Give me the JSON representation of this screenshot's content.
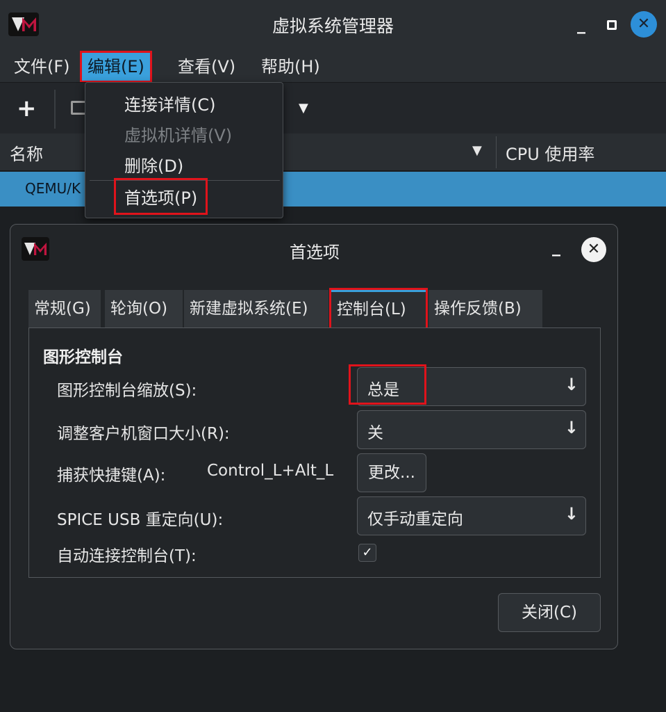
{
  "window": {
    "title": "虚拟系统管理器",
    "min_glyph": "_",
    "close_glyph": "✕"
  },
  "menubar": {
    "file": "文件(F)",
    "edit": "编辑(E)",
    "view": "查看(V)",
    "help": "帮助(H)"
  },
  "toolbar": {
    "add_glyph": "+",
    "dropdown_glyph": "▼"
  },
  "list": {
    "col_name": "名称",
    "col_sort_glyph": "▼",
    "col_cpu": "CPU 使用率",
    "row_text": "QEMU/K"
  },
  "edit_menu": {
    "connection_details": "连接详情(C)",
    "vm_details": "虚拟机详情(V)",
    "delete": "删除(D)",
    "preferences": "首选项(P)"
  },
  "dialog": {
    "title": "首选项",
    "min_glyph": "_",
    "close_glyph": "✕",
    "tabs": {
      "general": "常规(G)",
      "polling": "轮询(O)",
      "new_vm": "新建虚拟系统(E)",
      "console": "控制台(L)",
      "feedback": "操作反馈(B)"
    },
    "section_title": "图形控制台",
    "fields": {
      "scaling_label": "图形控制台缩放(S):",
      "scaling_value": "总是",
      "resize_label": "调整客户机窗口大小(R):",
      "resize_value": "关",
      "grab_label": "捕获快捷键(A):",
      "grab_value": "Control_L+Alt_L",
      "change_button": "更改...",
      "spice_label": "SPICE USB 重定向(U):",
      "spice_value": "仅手动重定向",
      "autoconnect_label": "自动连接控制台(T):",
      "autoconnect_checked": true,
      "check_glyph": "✓"
    },
    "dropdown_arrow": "↓",
    "close_button": "关闭(C)"
  }
}
